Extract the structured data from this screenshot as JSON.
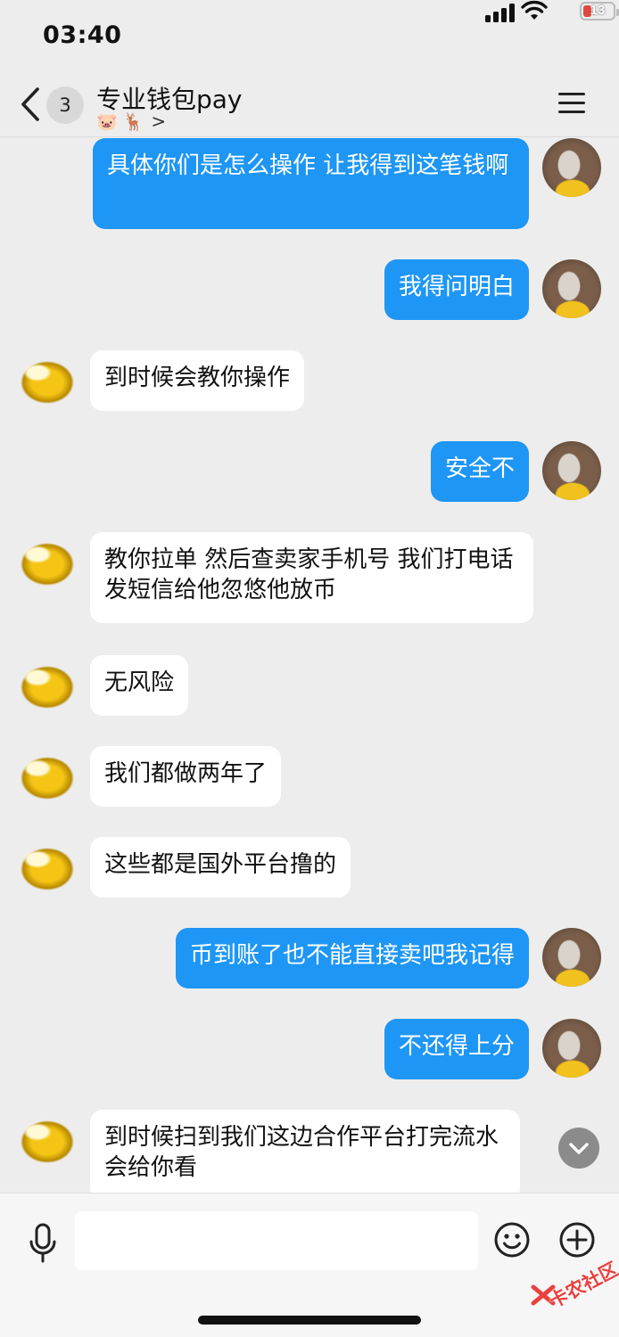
{
  "status_bar": {
    "time": "03:40",
    "battery": "13",
    "battery_color": "#e0473f"
  },
  "header": {
    "back_icon": "chevron-left-icon",
    "unread_count": "3",
    "title": "专业钱包pay",
    "subtitle_emoji": "🐷 🦌",
    "subtitle_chevron": ">",
    "menu_icon": "hamburger-menu-icon"
  },
  "messages": [
    {
      "from": "me",
      "text": "具体你们是怎么操作 让我得到这笔钱啊"
    },
    {
      "from": "me",
      "text": "我得问明白"
    },
    {
      "from": "them",
      "text": "到时候会教你操作"
    },
    {
      "from": "me",
      "text": "安全不"
    },
    {
      "from": "them",
      "text": "教你拉单 然后查卖家手机号 我们打电话发短信给他忽悠他放币"
    },
    {
      "from": "them",
      "text": "无风险"
    },
    {
      "from": "them",
      "text": "我们都做两年了"
    },
    {
      "from": "them",
      "text": "这些都是国外平台撸的"
    },
    {
      "from": "me",
      "text": "币到账了也不能直接卖吧我记得"
    },
    {
      "from": "me",
      "text": "不还得上分"
    },
    {
      "from": "them",
      "text": "到时候扫到我们这边合作平台打完流水会给你看"
    }
  ],
  "input_bar": {
    "placeholder": "",
    "voice_icon": "microphone-icon",
    "emoji_icon": "smiley-icon",
    "add_icon": "plus-circle-icon"
  },
  "watermark": "卡农社区",
  "colors": {
    "my_bubble": "#1e96f5",
    "their_bubble": "#ffffff",
    "background": "#ededed"
  }
}
